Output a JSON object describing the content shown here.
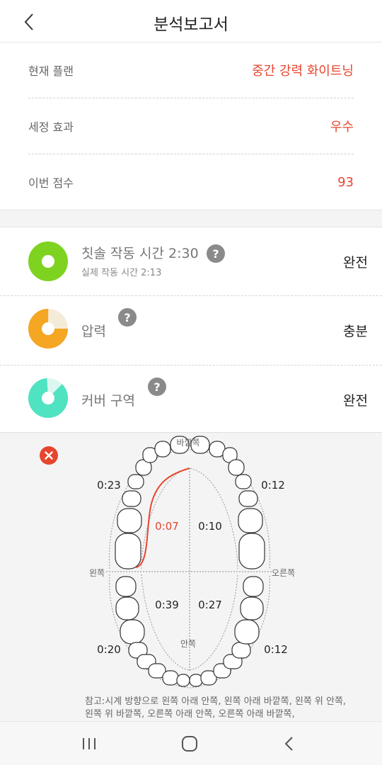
{
  "header": {
    "title": "분석보고서",
    "back_icon": "chevron-left-icon"
  },
  "summary": {
    "rows": [
      {
        "label": "현재 플랜",
        "value": "중간 강력 화이트닝"
      },
      {
        "label": "세정 효과",
        "value": "우수"
      },
      {
        "label": "이번 점수",
        "value": "93"
      }
    ],
    "value_color": "#e8452e"
  },
  "metrics": [
    {
      "title": "칫솔 작동 시간 2:30",
      "subtitle": "실제 작동 시간 2:13",
      "status": "완전",
      "help": "?",
      "fill_fraction": 1.0,
      "color": "#7ed321"
    },
    {
      "title": "압력",
      "status": "충분",
      "help": "?",
      "fill_fraction": 0.75,
      "color": "#f5a623"
    },
    {
      "title": "커버 구역",
      "status": "완전",
      "help": "?",
      "fill_fraction": 0.9,
      "color": "#50e3c2"
    }
  ],
  "teeth_map": {
    "labels": {
      "outer": "바깥쪽",
      "inner": "안쪽",
      "left": "왼쪽",
      "right": "오른쪽"
    },
    "times": {
      "upper_left_outer": "0:23",
      "upper_right_outer": "0:12",
      "upper_left_inner": "0:07",
      "upper_right_inner": "0:10",
      "lower_left_inner": "0:39",
      "lower_right_inner": "0:27",
      "lower_left_outer": "0:20",
      "lower_right_outer": "0:12"
    },
    "highlight_color": "#e8452e",
    "note": "참고:시계 방향으로 왼쪽 아래 안쪽, 왼쪽 아래 바깥쪽, 왼쪽 위 안쪽, 왼쪽 위 바깥쪽, 오른쪽 아래 안쪽, 오른쪽 아래 바깥쪽,"
  },
  "navbar": {
    "recents_icon": "recents-icon",
    "home_icon": "home-icon",
    "back_icon": "back-icon"
  }
}
